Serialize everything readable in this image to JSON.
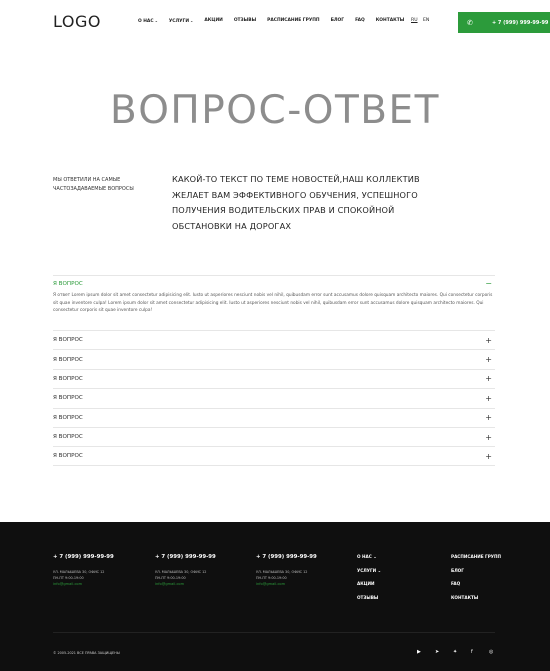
{
  "header": {
    "logo": "LOGO",
    "nav": [
      {
        "label": "О НАС",
        "chevron": true
      },
      {
        "label": "УСЛУГИ",
        "chevron": true
      },
      {
        "label": "АКЦИИ",
        "chevron": false
      },
      {
        "label": "ОТЗЫВЫ",
        "chevron": false
      },
      {
        "label": "РАСПИСАНИЕ ГРУПП",
        "chevron": false
      },
      {
        "label": "БЛОГ",
        "chevron": false
      },
      {
        "label": "FAQ",
        "chevron": false
      },
      {
        "label": "КОНТАКТЫ",
        "chevron": false
      }
    ],
    "lang": {
      "ru": "RU",
      "en": "EN"
    },
    "phone": "+ 7 (999) 999-99-99",
    "accent": "#2c9b3b"
  },
  "hero": {
    "title": "ВОПРОС-ОТВЕТ"
  },
  "intro": {
    "left": "МЫ ОТВЕТИЛИ НА САМЫЕ ЧАСТОЗАДАВАЕМЫЕ ВОПРОСЫ",
    "right": "КАКОЙ-ТО ТЕКСТ ПО ТЕМЕ НОВОСТЕЙ,НАШ КОЛЛЕКТИВ ЖЕЛАЕТ ВАМ ЭФФЕКТИВНОГО ОБУЧЕНИЯ, УСПЕШНОГО ПОЛУЧЕНИЯ ВОДИТЕЛЬСКИХ ПРАВ И СПОКОЙНОЙ ОБСТАНОВКИ НА ДОРОГАХ"
  },
  "faq": {
    "open": {
      "question": "Я ВОПРОС",
      "answer": "Я ответ Lorem ipsum dolor sit amet consectetur adipisicing elit. Iusto ut asperiores nesciunt nobis vel nihil, quibusdam error sunt accusamus dolore quisquam architecto maiores. Qui consectetur corporis sit quae inventore culpa! Lorem ipsum dolor sit amet consectetur adipisicing elit. Iusto ut asperiores nesciunt nobis vel nihil, quibusdam error sunt accusamus dolore quisquam architecto maiores. Qui consectetur corporis sit quae inventore culpa!",
      "sign": "−"
    },
    "items": [
      {
        "question": "Я ВОПРОС",
        "sign": "+"
      },
      {
        "question": "Я ВОПРОС",
        "sign": "+"
      },
      {
        "question": "Я ВОПРОС",
        "sign": "+"
      },
      {
        "question": "Я ВОПРОС",
        "sign": "+"
      },
      {
        "question": "Я ВОПРОС",
        "sign": "+"
      },
      {
        "question": "Я ВОПРОС",
        "sign": "+"
      },
      {
        "question": "Я ВОПРОС",
        "sign": "+"
      }
    ]
  },
  "footer": {
    "contacts": [
      {
        "phone": "+ 7 (999) 999-99-99",
        "address": "УЛ. МАЛЫШЕВА 30, ОФИС 12",
        "hours": "ПН-ПТ 9:00-19:00",
        "email": "info@gmail.com"
      },
      {
        "phone": "+ 7 (999) 999-99-99",
        "address": "УЛ. МАЛЫШЕВА 30, ОФИС 12",
        "hours": "ПН-ПТ 9:00-19:00",
        "email": "info@gmail.com"
      },
      {
        "phone": "+ 7 (999) 999-99-99",
        "address": "УЛ. МАЛЫШЕВА 30, ОФИС 12",
        "hours": "ПН-ПТ 9:00-19:00",
        "email": "info@gmail.com"
      }
    ],
    "menu1": [
      "О НАС ⌄",
      "УСЛУГИ ⌄",
      "АКЦИИ",
      "ОТЗЫВЫ"
    ],
    "menu2": [
      "РАСПИСАНИЕ ГРУПП",
      "БЛОГ",
      "FAQ",
      "КОНТАКТЫ"
    ],
    "copyright": "© 2005-2021 ВСЕ ПРАВА ЗАЩИЩЕНЫ",
    "socials": [
      "youtube-icon",
      "telegram-icon",
      "twitter-icon",
      "facebook-icon",
      "instagram-icon"
    ]
  }
}
